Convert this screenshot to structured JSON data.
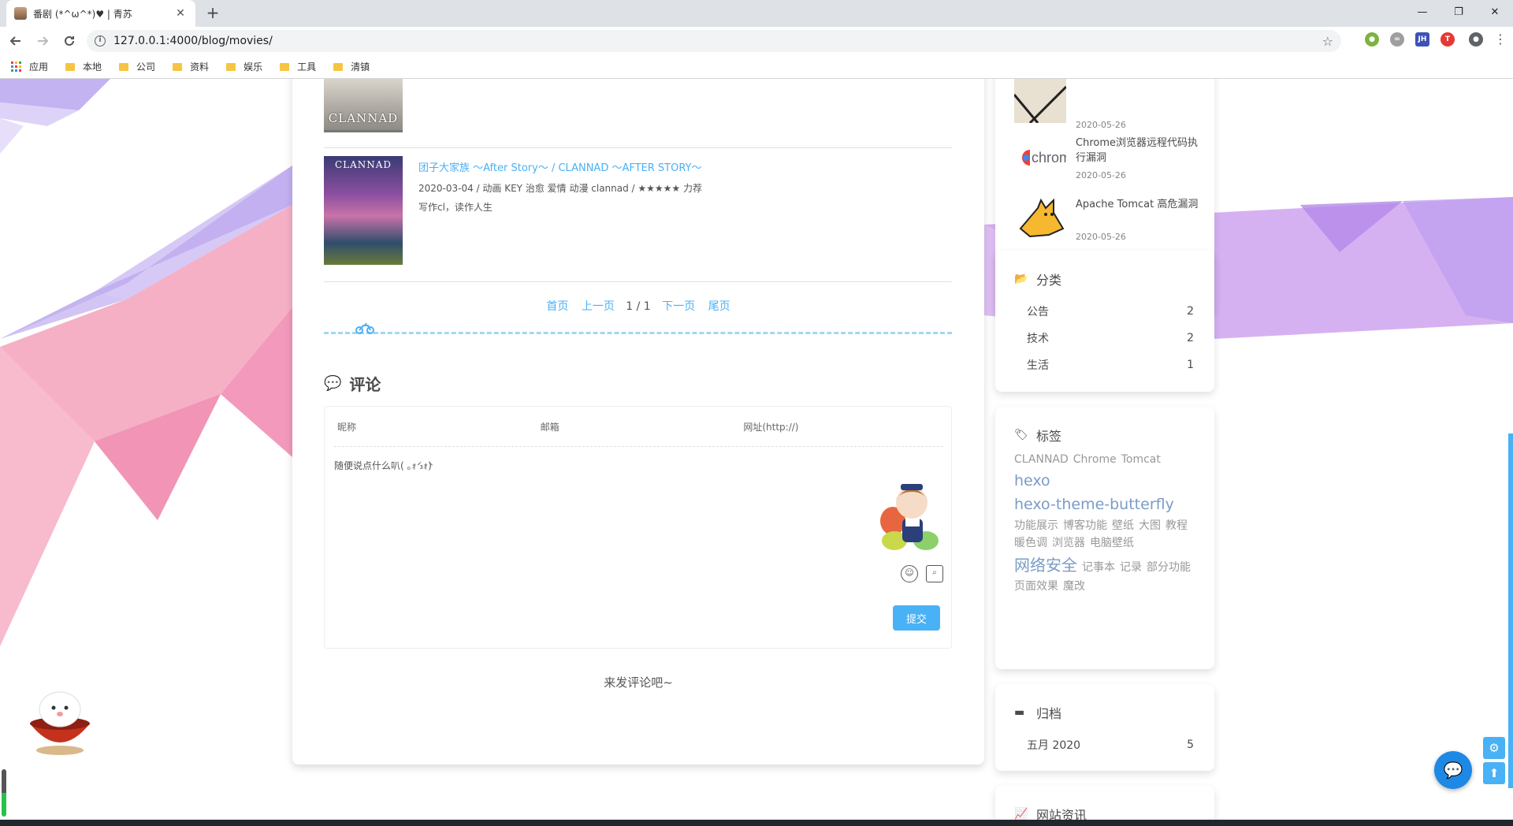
{
  "browser": {
    "tab_title": "番剧 (*^ω^*)♥ | 青苏",
    "new_tab": "+",
    "url": "127.0.0.1:4000/blog/movies/",
    "window_controls": [
      "—",
      "❐",
      "✕"
    ],
    "bookmarks": [
      "应用",
      "本地",
      "公司",
      "资料",
      "娱乐",
      "工具",
      "清镇"
    ]
  },
  "content": {
    "prev_thumb_label": "CLANNAD",
    "movie": {
      "poster_label": "CLANNAD",
      "title": "团子大家族 ～After Story～ / CLANNAD ～AFTER STORY～",
      "meta": "2020-03-04 / 动画 KEY 治愈 爱情 动漫 clannad / ★★★★★ 力荐",
      "note": "写作cl，读作人生"
    },
    "pager": {
      "first": "首页",
      "prev": "上一页",
      "current": "1 / 1",
      "next": "下一页",
      "last": "尾页"
    },
    "comments": {
      "heading": "评论",
      "nick_placeholder": "昵称",
      "mail_placeholder": "邮箱",
      "url_placeholder": "网址(http://)",
      "textarea_placeholder": "随便说点什么叭( ｡ｫ́ ₃ｫ̀)",
      "submit": "提交",
      "empty": "来发评论吧~"
    }
  },
  "sidebar": {
    "recent": [
      {
        "title": "",
        "date": "2020-05-26"
      },
      {
        "title": "Chrome浏览器远程代码执行漏洞",
        "date": "2020-05-26"
      },
      {
        "title": "Apache Tomcat 高危漏洞",
        "date": "2020-05-26"
      }
    ],
    "categories": {
      "heading": "分类",
      "items": [
        {
          "name": "公告",
          "count": "2"
        },
        {
          "name": "技术",
          "count": "2"
        },
        {
          "name": "生活",
          "count": "1"
        }
      ]
    },
    "tags": {
      "heading": "标签",
      "items": [
        {
          "name": "CLANNAD",
          "size": 14
        },
        {
          "name": "Chrome",
          "size": 14
        },
        {
          "name": "Tomcat",
          "size": 14
        },
        {
          "name": "hexo",
          "size": 19
        },
        {
          "name": "hexo-theme-butterfly",
          "size": 19
        },
        {
          "name": "功能展示",
          "size": 14
        },
        {
          "name": "博客功能",
          "size": 14
        },
        {
          "name": "壁纸",
          "size": 14
        },
        {
          "name": "大图",
          "size": 14
        },
        {
          "name": "教程",
          "size": 14
        },
        {
          "name": "暖色调",
          "size": 14
        },
        {
          "name": "浏览器",
          "size": 14
        },
        {
          "name": "电脑壁纸",
          "size": 14
        },
        {
          "name": "网络安全",
          "size": 20
        },
        {
          "name": "记事本",
          "size": 14
        },
        {
          "name": "记录",
          "size": 14
        },
        {
          "name": "部分功能",
          "size": 14
        },
        {
          "name": "页面效果",
          "size": 14
        },
        {
          "name": "魔改",
          "size": 14
        }
      ]
    },
    "archive": {
      "heading": "归档",
      "items": [
        {
          "name": "五月 2020",
          "count": "5"
        }
      ]
    },
    "site": {
      "heading": "网站资讯"
    }
  },
  "colors": {
    "accent": "#49b1f5",
    "text": "#4c4948",
    "chat": "#1e88e5"
  },
  "icons": [
    "info-icon",
    "star-icon",
    "folder-icon",
    "comment-icon",
    "emoji-icon",
    "preview-icon",
    "folder-open-icon",
    "tags-icon",
    "archive-icon",
    "chart-icon",
    "gear-icon",
    "arrow-up-icon",
    "chat-icon",
    "motorcycle-icon"
  ]
}
